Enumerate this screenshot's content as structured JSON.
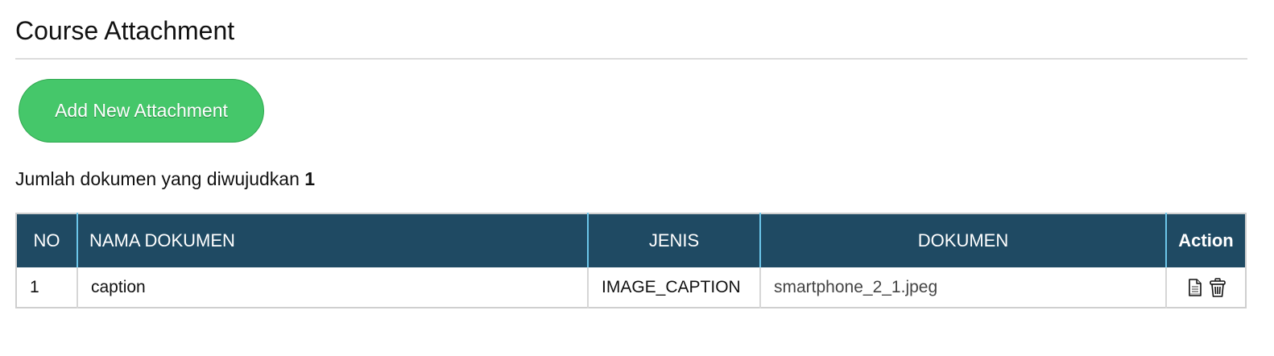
{
  "page": {
    "title": "Course Attachment"
  },
  "toolbar": {
    "add_label": "Add New Attachment"
  },
  "summary": {
    "label": "Jumlah dokumen yang diwujudkan",
    "count": "1"
  },
  "table": {
    "headers": {
      "no": "NO",
      "nama": "NAMA DOKUMEN",
      "jenis": "JENIS",
      "dokumen": "DOKUMEN",
      "action": "Action"
    },
    "rows": [
      {
        "no": "1",
        "nama": "caption",
        "jenis": "IMAGE_CAPTION",
        "dokumen": "smartphone_2_1.jpeg",
        "actions": [
          "view-document-icon",
          "delete-trash-icon"
        ]
      }
    ]
  },
  "colors": {
    "button_green": "#45c76a",
    "header_navy": "#1f4a63",
    "header_divider": "#6cc6ea"
  }
}
